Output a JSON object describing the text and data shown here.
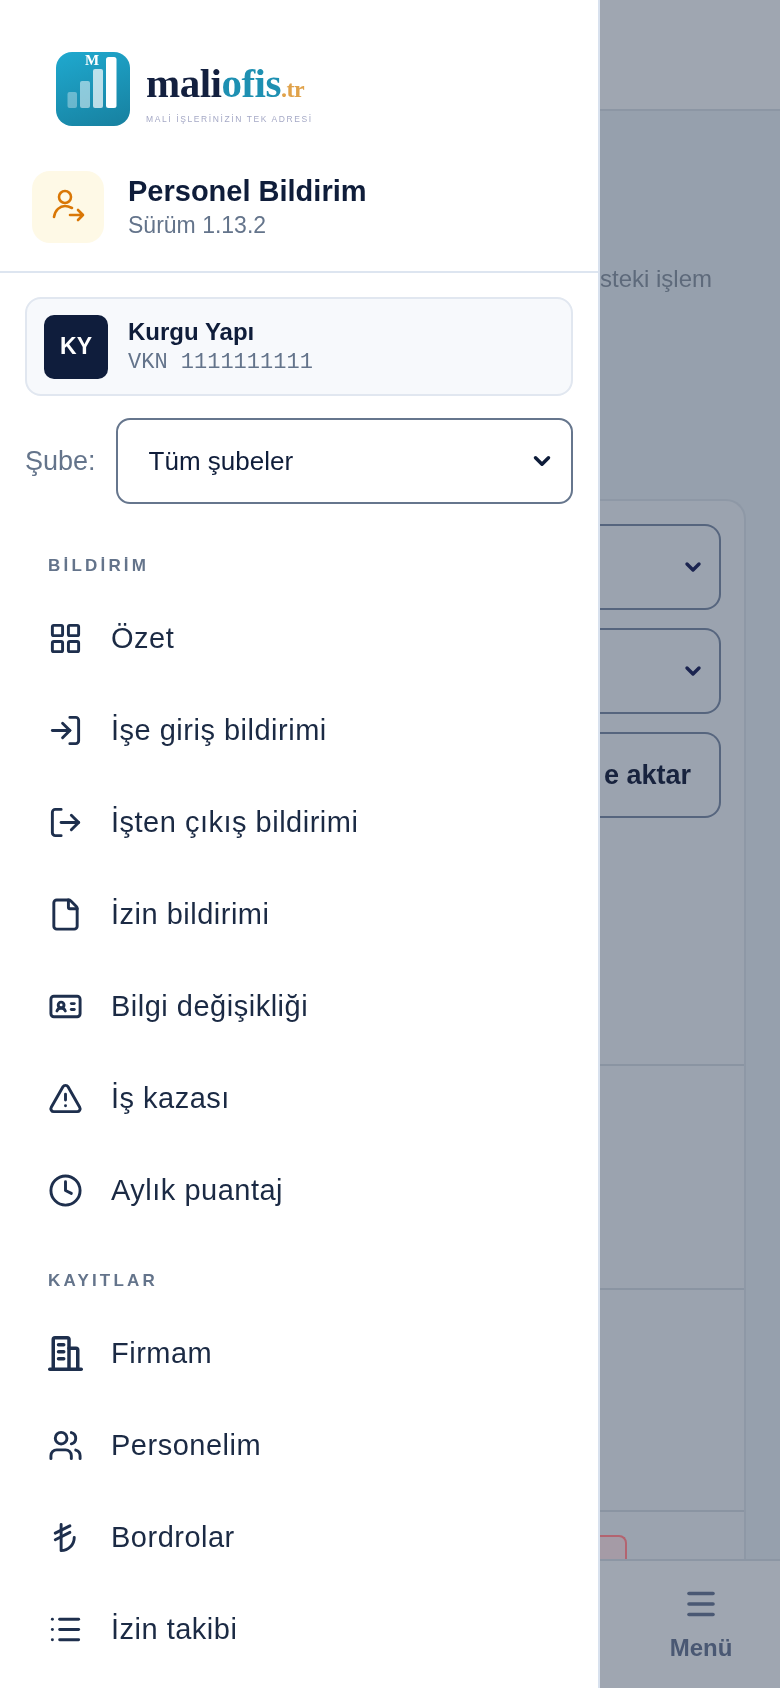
{
  "logo": {
    "tile_letter": "M",
    "wordmark": [
      "mali",
      "ofis",
      ".tr"
    ],
    "tagline": "MALİ İŞLERİNİZİN TEK ADRESİ"
  },
  "app": {
    "title": "Personel Bildirim",
    "version": "Sürüm 1.13.2"
  },
  "company": {
    "initials": "KY",
    "name": "Kurgu Yapı",
    "tax_id": "VKN 1111111111"
  },
  "branch": {
    "label": "Şube:",
    "value": "Tüm şubeler"
  },
  "menu_sections": [
    {
      "title": "BİLDİRİM",
      "items": [
        {
          "label": "Özet",
          "selected": false
        },
        {
          "label": "İşe giriş bildirimi",
          "selected": false
        },
        {
          "label": "İşten çıkış bildirimi",
          "selected": false
        },
        {
          "label": "İzin bildirimi",
          "selected": false
        },
        {
          "label": "Bilgi değişikliği",
          "selected": false
        },
        {
          "label": "İş kazası",
          "selected": false
        },
        {
          "label": "Aylık puantaj",
          "selected": false
        }
      ]
    },
    {
      "title": "KAYITLAR",
      "items": [
        {
          "label": "Firmam",
          "selected": false
        },
        {
          "label": "Personelim",
          "selected": false
        },
        {
          "label": "Bordrolar",
          "selected": false
        },
        {
          "label": "İzin takibi",
          "selected": false
        }
      ]
    }
  ],
  "background_page": {
    "text_fragment": "steki işlem",
    "filters": [
      {
        "kind": "select"
      },
      {
        "kind": "select"
      },
      {
        "kind": "button",
        "label": "e aktar"
      }
    ],
    "bottom_nav": [
      {
        "label": "Menü"
      }
    ]
  }
}
